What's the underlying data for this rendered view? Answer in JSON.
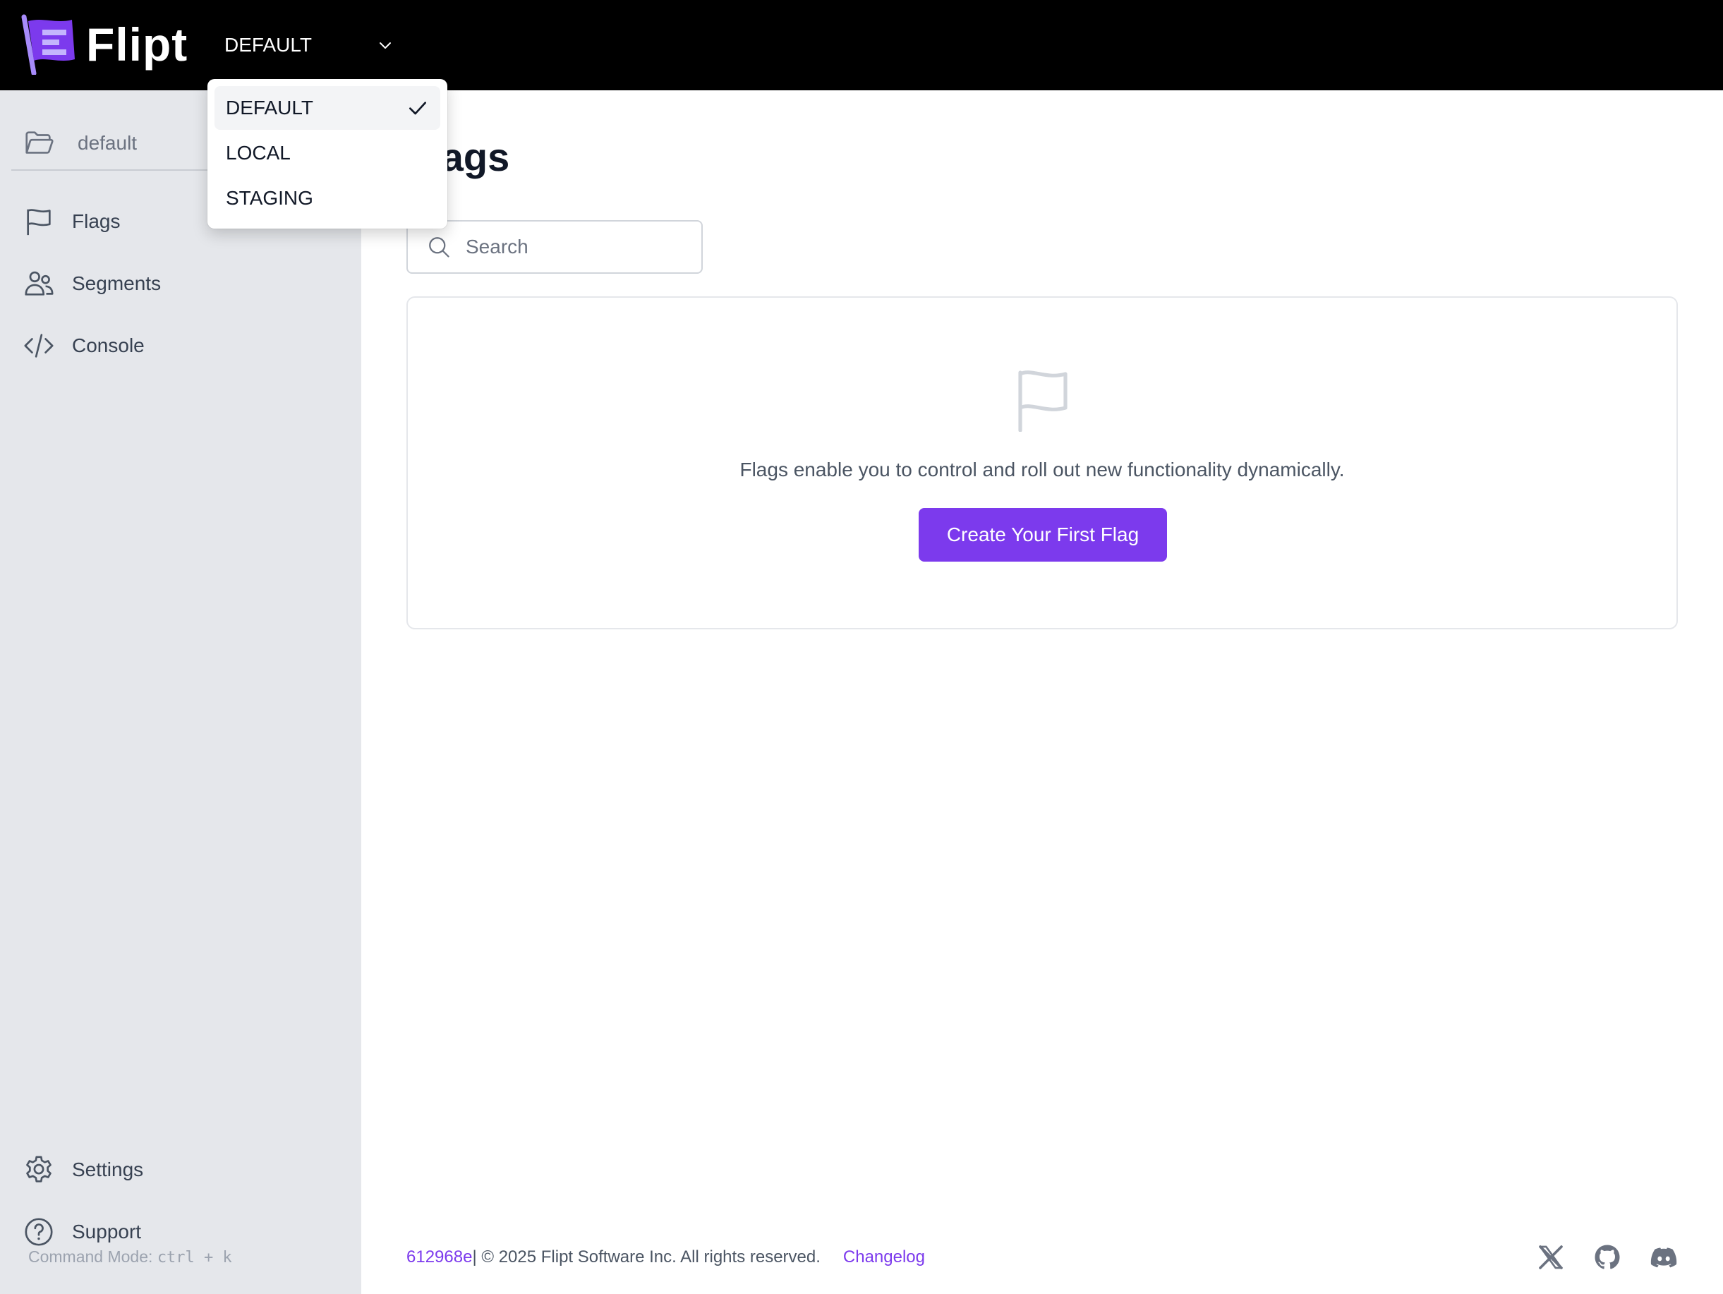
{
  "app": {
    "logo_text": "Flipt",
    "accent": "#7c3aed"
  },
  "environment": {
    "selected": "DEFAULT",
    "options": [
      {
        "label": "DEFAULT",
        "checked": true
      },
      {
        "label": "LOCAL",
        "checked": false
      },
      {
        "label": "STAGING",
        "checked": false
      }
    ]
  },
  "sidebar": {
    "namespace": "default",
    "items": [
      {
        "label": "Flags",
        "icon": "flag-icon"
      },
      {
        "label": "Segments",
        "icon": "users-icon"
      },
      {
        "label": "Console",
        "icon": "code-icon"
      }
    ],
    "bottom_items": [
      {
        "label": "Settings",
        "icon": "gear-icon"
      },
      {
        "label": "Support",
        "icon": "question-icon"
      }
    ],
    "command_mode_label": "Command Mode:",
    "command_mode_keys": "ctrl + k"
  },
  "main": {
    "title": "Flags",
    "search_placeholder": "Search",
    "empty_state_text": "Flags enable you to control and roll out new functionality dynamically.",
    "create_button": "Create Your First Flag"
  },
  "footer": {
    "commit": "612968e",
    "copyright": " | © 2025 Flipt Software Inc. All rights reserved.",
    "changelog": "Changelog",
    "social": [
      "x-icon",
      "github-icon",
      "discord-icon"
    ]
  }
}
